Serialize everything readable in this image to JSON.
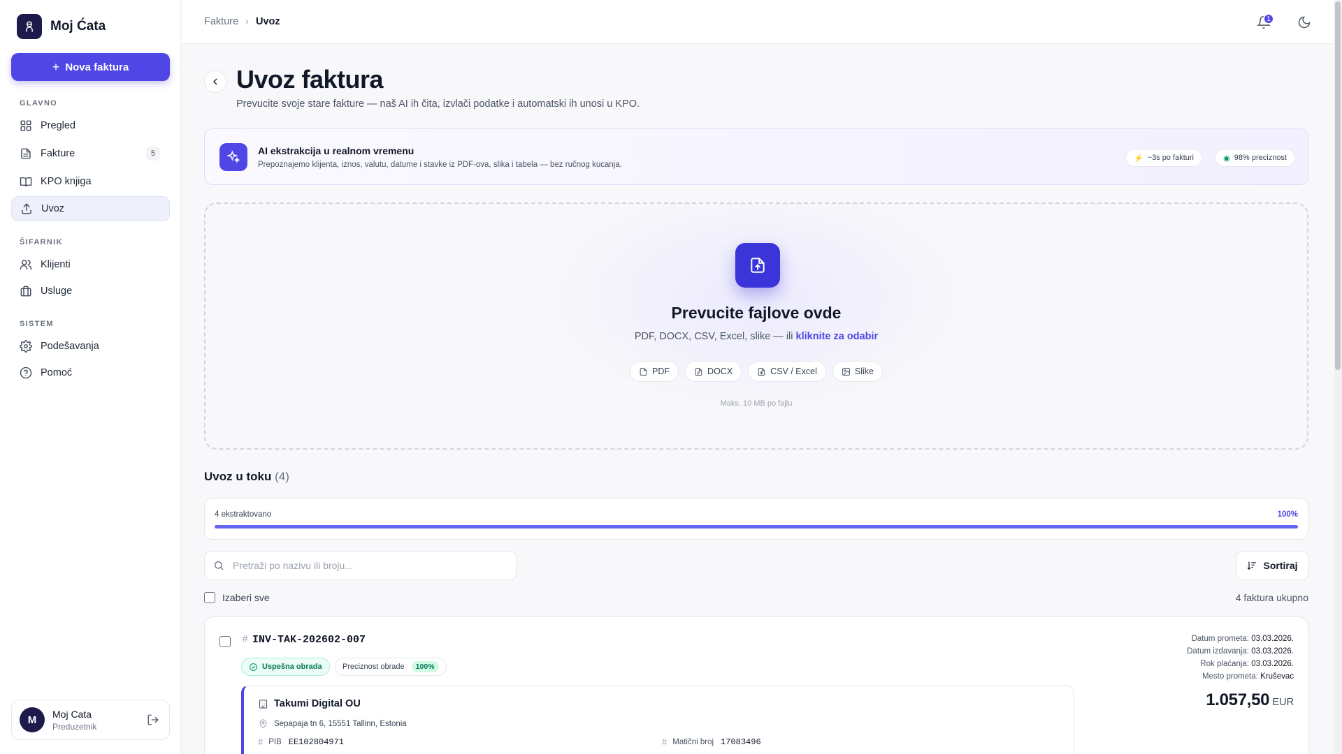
{
  "app": {
    "name": "Moj Ćata",
    "new_invoice": "Nova faktura"
  },
  "sidebar": {
    "sections": [
      "GLAVNO",
      "ŠIFARNIK",
      "SISTEM"
    ],
    "items": [
      {
        "label": "Pregled",
        "icon": "grid-icon"
      },
      {
        "label": "Fakture",
        "icon": "file-icon",
        "count": "5"
      },
      {
        "label": "KPO knjiga",
        "icon": "book-icon"
      },
      {
        "label": "Uvoz",
        "icon": "upload-icon",
        "active": true
      },
      {
        "label": "Klijenti",
        "icon": "users-icon"
      },
      {
        "label": "Usluge",
        "icon": "briefcase-icon"
      },
      {
        "label": "Podešavanja",
        "icon": "gear-icon"
      },
      {
        "label": "Pomoć",
        "icon": "help-icon"
      }
    ],
    "user": {
      "initial": "M",
      "name": "Moj Cata",
      "role": "Preduzetnik"
    }
  },
  "header": {
    "breadcrumb": [
      "Fakture",
      "Uvoz"
    ],
    "notifications": "1"
  },
  "page": {
    "title": "Uvoz faktura",
    "subtitle": "Prevucite svoje stare fakture — naš AI ih čita, izvlači podatke i automatski ih unosi u KPO."
  },
  "ai_banner": {
    "title": "AI ekstrakcija u realnom vremenu",
    "desc": "Prepoznajemo klijenta, iznos, valutu, datume i stavke iz PDF-ova, slika i tabela — bez ručnog kucanja.",
    "pill_speed": "~3s po fakturi",
    "pill_accuracy": "98% preciznost"
  },
  "dropzone": {
    "title": "Prevucite fajlove ovde",
    "desc": "PDF, DOCX, CSV, Excel, slike — ili",
    "link": "kliknite za odabir",
    "chips": [
      "PDF",
      "DOCX",
      "CSV / Excel",
      "Slike"
    ],
    "max": "Maks. 10 MB po fajlu"
  },
  "queue": {
    "title": "Uvoz u toku",
    "count": "(4)",
    "progress_label": "4 ekstraktovano",
    "progress_pct": "100%",
    "progress_value": 1.0,
    "search_placeholder": "Pretraži po nazivu ili broju...",
    "sort_label": "Sortiraj",
    "select_all": "Izaberi sve",
    "total": "4 faktura ukupno"
  },
  "invoice": {
    "number": "INV-TAK-202602-007",
    "status": "Uspešna obrada",
    "accuracy_label": "Preciznost obrade",
    "accuracy": "100%",
    "client": "Takumi Digital OU",
    "address": "Sepapaja tn 6, 15551 Tallinn, Estonia",
    "pib_label": "PIB",
    "pib": "EE102804971",
    "mb_label": "Matični broj",
    "mb": "17083496",
    "datum_prometa_label": "Datum prometa:",
    "datum_prometa": "03.03.2026.",
    "datum_izdavanja_label": "Datum izdavanja:",
    "datum_izdavanja": "03.03.2026.",
    "rok_label": "Rok plaćanja:",
    "rok": "03.03.2026.",
    "mesto_label": "Mesto prometa:",
    "mesto": "Kruševac",
    "amount": "1.057,50",
    "currency": "EUR"
  },
  "colors": {
    "accent": "#4f46e5",
    "success": "#059669"
  }
}
